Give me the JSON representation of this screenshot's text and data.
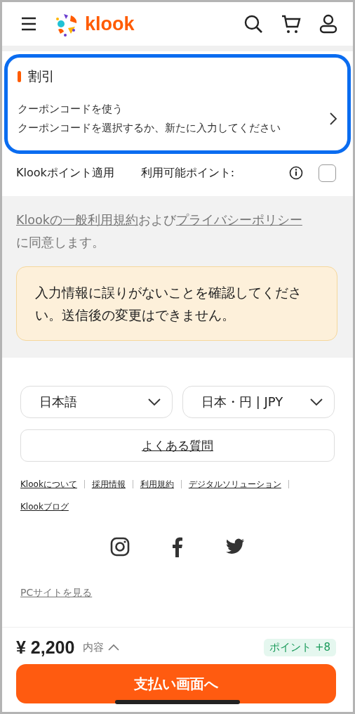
{
  "header": {
    "logo_text": "klook"
  },
  "discount": {
    "title": "割引",
    "coupon_title": "クーポンコードを使う",
    "coupon_hint": "クーポンコードを選択するか、新たに入力してください"
  },
  "points": {
    "label": "Klookポイント適用",
    "available_label": "利用可能ポイント:",
    "checked": false
  },
  "terms": {
    "parts": [
      {
        "kind": "link",
        "text": "Klookの一般利用規約"
      },
      {
        "kind": "text",
        "text": "および"
      },
      {
        "kind": "link",
        "text": "プライバシーポリシー"
      },
      {
        "kind": "text",
        "text": "に同意します。"
      }
    ]
  },
  "notice": {
    "text": "入力情報に誤りがないことを確認してください。送信後の変更はできません。"
  },
  "footer": {
    "language": "日本語",
    "currency": "日本・円 | JPY",
    "faq": "よくある質問",
    "links": [
      "Klookについて",
      "採用情報",
      "利用規約",
      "デジタルソリューション",
      "Klookブログ"
    ],
    "pc_site": "PCサイトを見る"
  },
  "bottom_bar": {
    "price": "¥ 2,200",
    "details": "内容",
    "points_badge": "ポイント +8",
    "pay_button": "支払い画面へ"
  }
}
